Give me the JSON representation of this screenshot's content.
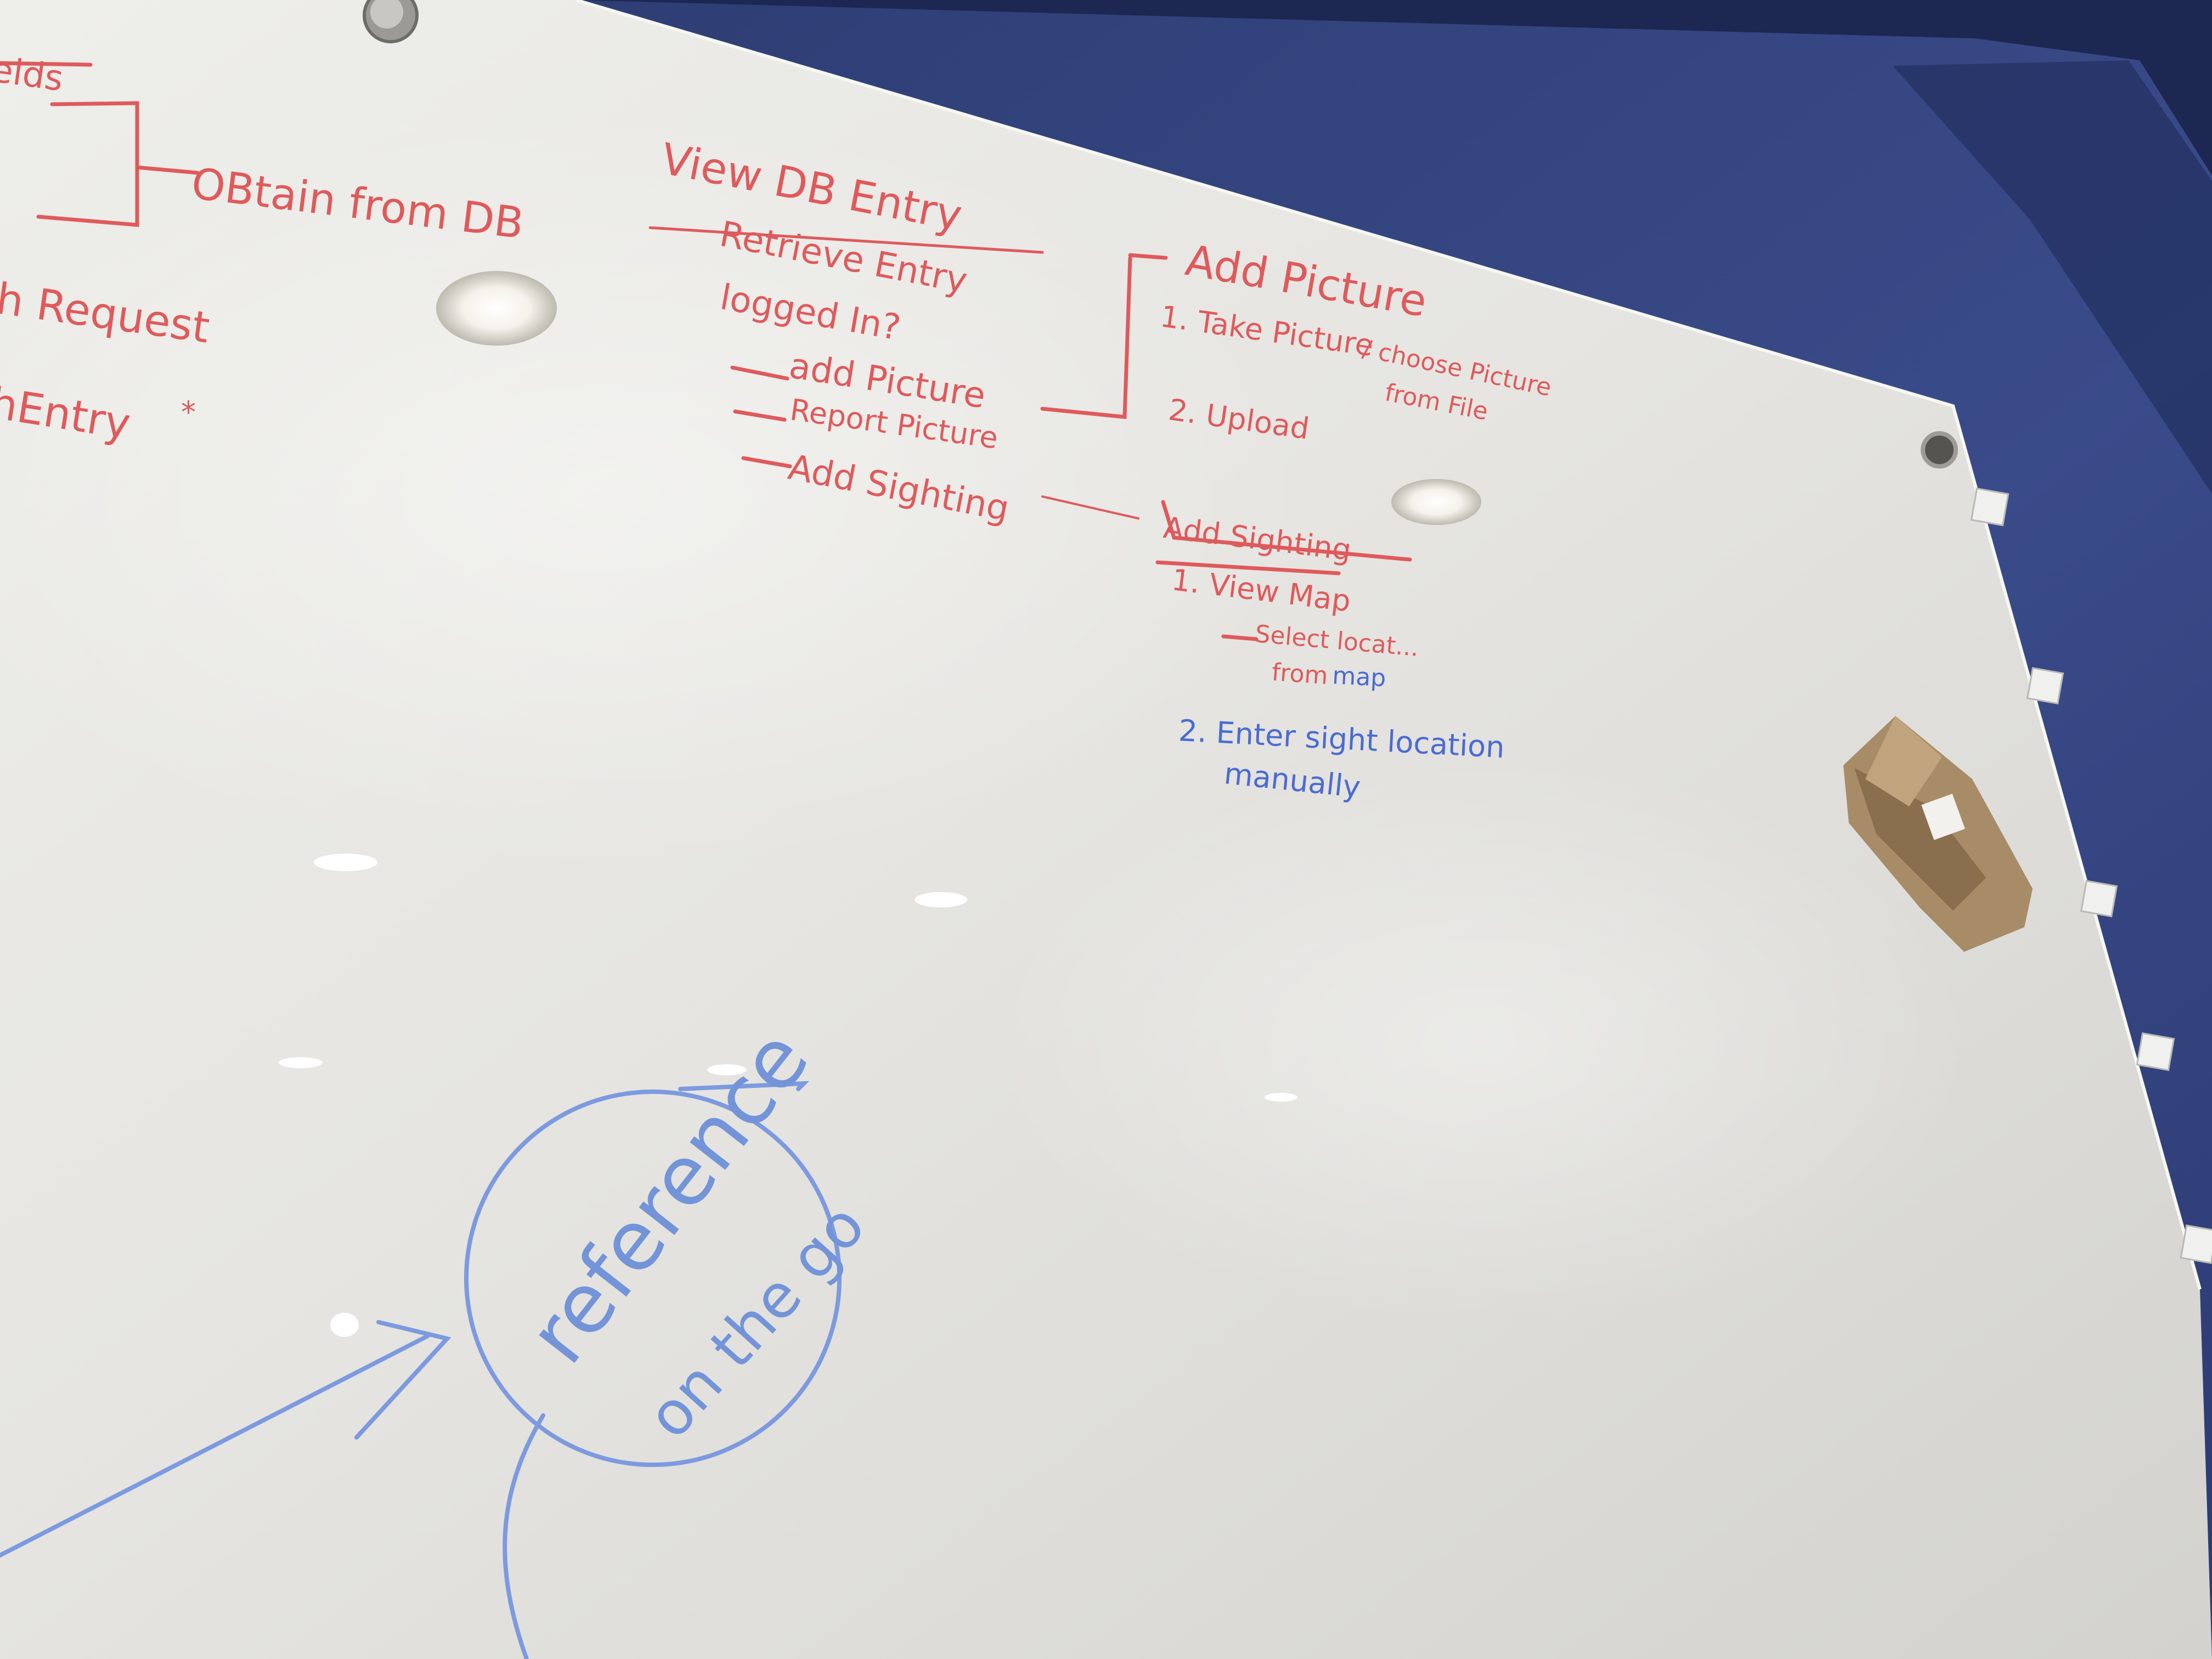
{
  "whiteboard": {
    "left_column": {
      "fields_fragment": "elds",
      "obtain": "OBtain from DB",
      "request": "h Request",
      "entry": "hEntry",
      "entry_mark": "*"
    },
    "view_db": {
      "title": "View DB Entry",
      "items": [
        "Retrieve Entry",
        "logged In?"
      ],
      "sub_items": [
        "add Picture",
        "Report Picture",
        "Add Sighting"
      ]
    },
    "add_picture": {
      "title": "Add Picture",
      "step1": "1. Take Picture",
      "step1_alt": "/ choose Picture",
      "step1_alt2": "from File",
      "step2": "2. Upload"
    },
    "add_sighting": {
      "title": "Add Sighting",
      "step1": "1. View Map",
      "sub1": "Select locat...",
      "sub2": "from",
      "sub2_map": "map",
      "step2_line1": "2. Enter sight location",
      "step2_line2": "manually"
    },
    "bubble": {
      "line1": "reference",
      "line2": "on the go"
    }
  },
  "colors": {
    "wall": "#1e2a4e",
    "board": "#e9e8e4",
    "red_marker": "#df5a5c",
    "blue_marker": "#4a6bd3",
    "light_blue_marker": "#7394d8"
  }
}
